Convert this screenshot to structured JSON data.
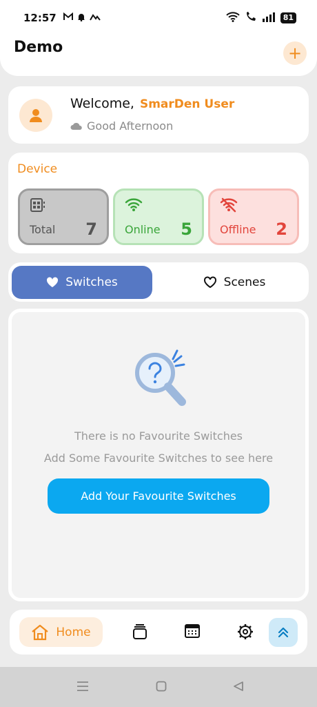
{
  "status_bar": {
    "time": "12:57",
    "battery": "81",
    "icons": [
      "gmail-icon",
      "bell-icon",
      "signal-app-icon",
      "wifi-icon",
      "wifi-call-icon",
      "cell-signal-icon",
      "battery-icon"
    ]
  },
  "header": {
    "title": "Demo",
    "add_label": "+"
  },
  "welcome": {
    "greeting": "Welcome,",
    "user": "SmarDen User",
    "subtitle": "Good Afternoon",
    "icons": [
      "user-icon",
      "cloud-icon"
    ]
  },
  "device": {
    "title": "Device",
    "stats": [
      {
        "label": "Total",
        "value": "7",
        "icon": "device-icon"
      },
      {
        "label": "Online",
        "value": "5",
        "icon": "wifi-icon"
      },
      {
        "label": "Offline",
        "value": "2",
        "icon": "wifi-off-icon"
      }
    ]
  },
  "tabs": [
    {
      "label": "Switches",
      "icon": "heart-filled-icon",
      "active": true
    },
    {
      "label": "Scenes",
      "icon": "heart-outline-icon",
      "active": false
    }
  ],
  "empty_state": {
    "title": "There is no Favourite Switches",
    "subtitle": "Add Some Favourite Switches to see here",
    "button": "Add Your Favourite Switches",
    "icon": "search-question-icon"
  },
  "bottom_nav": {
    "home_label": "Home",
    "icons": [
      "home-icon",
      "scenes-stack-icon",
      "calendar-icon",
      "settings-icon",
      "double-chevron-up-icon"
    ]
  },
  "colors": {
    "accent": "#f08c1e",
    "tab_active": "#5678c4",
    "cta": "#0ba8f0",
    "online": "#3aa53a",
    "offline": "#e2453c"
  }
}
